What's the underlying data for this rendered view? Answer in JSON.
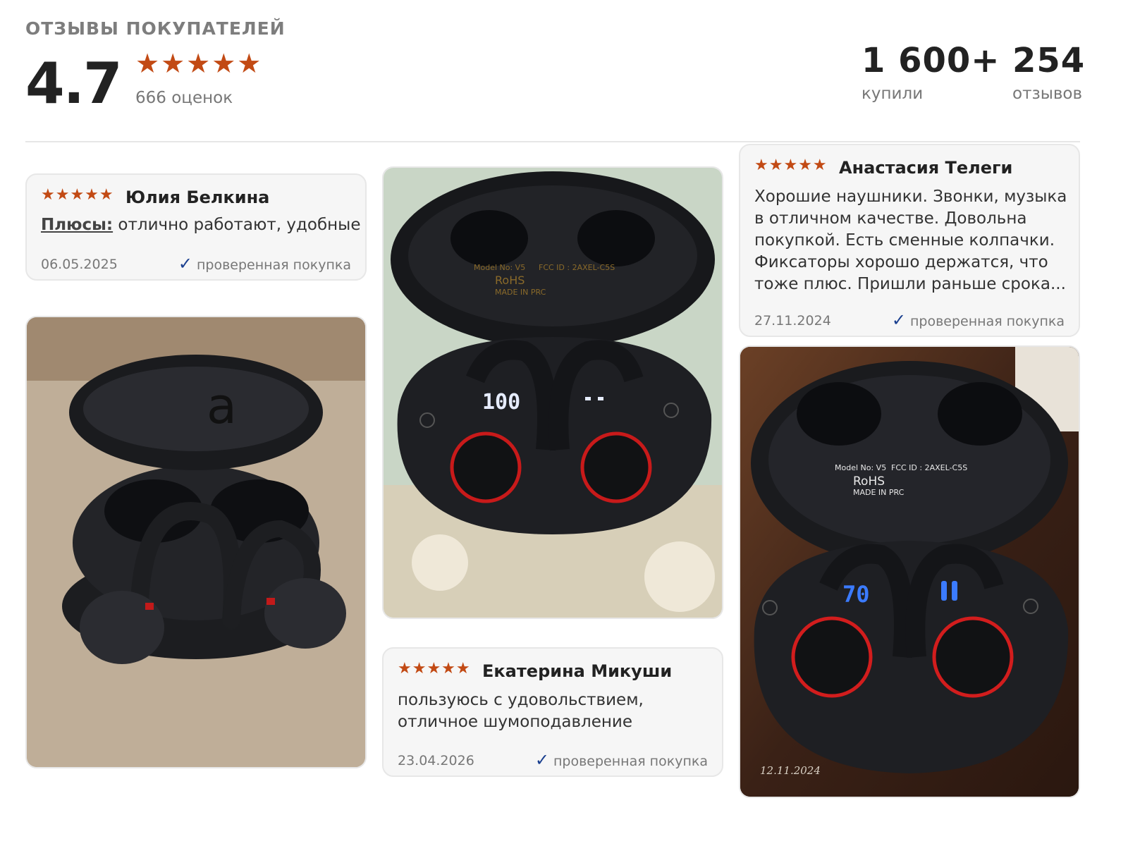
{
  "section_title": "ОТЗЫВЫ ПОКУПАТЕЛЕЙ",
  "rating": {
    "average": "4.7",
    "stars": "★★★★★",
    "count_text": "666 оценок"
  },
  "stats": {
    "bought_value": "1 600+",
    "bought_label": "купили",
    "reviews_value": "254",
    "reviews_label": "отзывов"
  },
  "reviews": [
    {
      "stars": "★★★★★",
      "name": "Юлия Белкина",
      "pros_label": "Плюсы:",
      "text": " отлично работают, удобные",
      "date": "06.05.2025",
      "verified": "проверенная покупка"
    },
    {
      "stars": "★★★★★",
      "name": "Екатерина Микуши",
      "text": "пользуюсь с удовольствием, отличное шумоподавление",
      "date": "23.04.2026",
      "verified": "проверенная покупка"
    },
    {
      "stars": "★★★★★",
      "name": "Анастасия Телеги",
      "text": "Хорошие наушники. Звонки, музыка в отличном качестве. Довольна покупкой. Есть сменные колпачки. Фиксаторы хорошо держатся, что тоже плюс. Пришли раньше срока...",
      "date": "27.11.2024",
      "verified": "проверенная покупка"
    }
  ],
  "photos": {
    "left_alt": "earbuds-photo",
    "middle_display_left": "100",
    "right_display_left": "70",
    "right_stamp": "12.11.2024",
    "case_model": "Model No: V5",
    "case_fcc": "FCC ID : 2AXEL-C5S",
    "case_rohs": "RoHS",
    "case_made": "MADE IN PRC"
  },
  "colors": {
    "star": "#c24a14",
    "check": "#1a3f8f"
  }
}
